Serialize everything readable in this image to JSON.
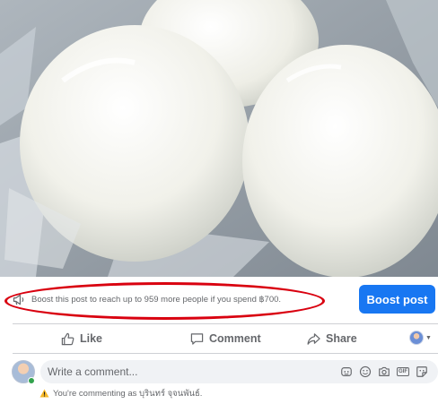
{
  "post": {
    "photo_alt": ""
  },
  "boost": {
    "message": "Boost this post to reach up to 959 more people if you spend ฿700.",
    "button_label": "Boost post"
  },
  "actions": {
    "like_label": "Like",
    "comment_label": "Comment",
    "share_label": "Share"
  },
  "comment_box": {
    "placeholder": "Write a comment...",
    "tools": [
      "sticker-avatar-icon",
      "emoji-icon",
      "camera-icon",
      "gif-icon",
      "sticker-icon"
    ]
  },
  "commenting_as": {
    "text": "You're commenting as บุรินทร์ จุจนพันธ์."
  },
  "colors": {
    "primary": "#1877f2",
    "highlight_ring": "#d9000f",
    "secondary_text": "#65676b",
    "input_bg": "#f0f2f5",
    "warning": "#f7b928",
    "online": "#31a24c"
  }
}
